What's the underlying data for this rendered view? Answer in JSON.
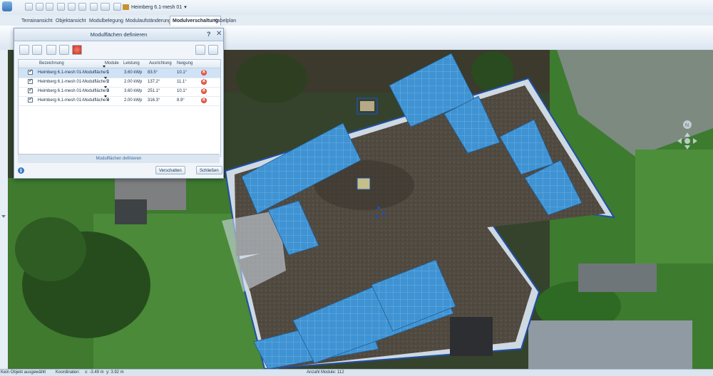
{
  "toolbar": {
    "project_name": "Heimberg 6.1-mesh 01",
    "project_dropdown": "▾"
  },
  "tabs": [
    {
      "label": "Terrainansicht"
    },
    {
      "label": "Objektansicht"
    },
    {
      "label": "Modulbelegung"
    },
    {
      "label": "Modulaufständerung"
    },
    {
      "label": "Modulverschaltung"
    },
    {
      "label": "Kabelplan"
    }
  ],
  "dialog": {
    "title": "Modulflächen definieren",
    "help": "?",
    "close": "✕",
    "columns": {
      "name": "Bezeichnung",
      "modules": "Module",
      "power": "Leistung",
      "orientation": "Ausrichtung",
      "tilt": "Neigung"
    },
    "rows": [
      {
        "name": "Heimberg 6.1-mesh 01-Modulfläche 1",
        "modules": "9",
        "power": "3.60 kWp",
        "orientation": "83.5°",
        "tilt": "10.1°"
      },
      {
        "name": "Heimberg 6.1-mesh 01-Modulfläche 2",
        "modules": "5",
        "power": "2.00 kWp",
        "orientation": "137.2°",
        "tilt": "11.1°"
      },
      {
        "name": "Heimberg 6.1-mesh 01-Modulfläche 3",
        "modules": "9",
        "power": "3.60 kWp",
        "orientation": "251.1°",
        "tilt": "10.1°"
      },
      {
        "name": "Heimberg 6.1-mesh 01-Modulfläche 4",
        "modules": "5",
        "power": "2.00 kWp",
        "orientation": "316.3°",
        "tilt": "8.9°"
      }
    ],
    "section_label": "Modulflächen definieren",
    "info": "i",
    "move_button": "Verschatten",
    "close_button": "Schließen"
  },
  "status": {
    "selection": "Kein Objekt ausgewählt",
    "coords_label": "Koordinaten:",
    "x": "x: -3.49 m",
    "y": "y: 3.92 m",
    "module_count": "Anzahl Module:  112"
  },
  "colors": {
    "panel": "#3a8fd0",
    "roof_edge": "#c8d6e2",
    "grass": "#3d7a2e",
    "ui_accent": "#3d6a9e"
  }
}
